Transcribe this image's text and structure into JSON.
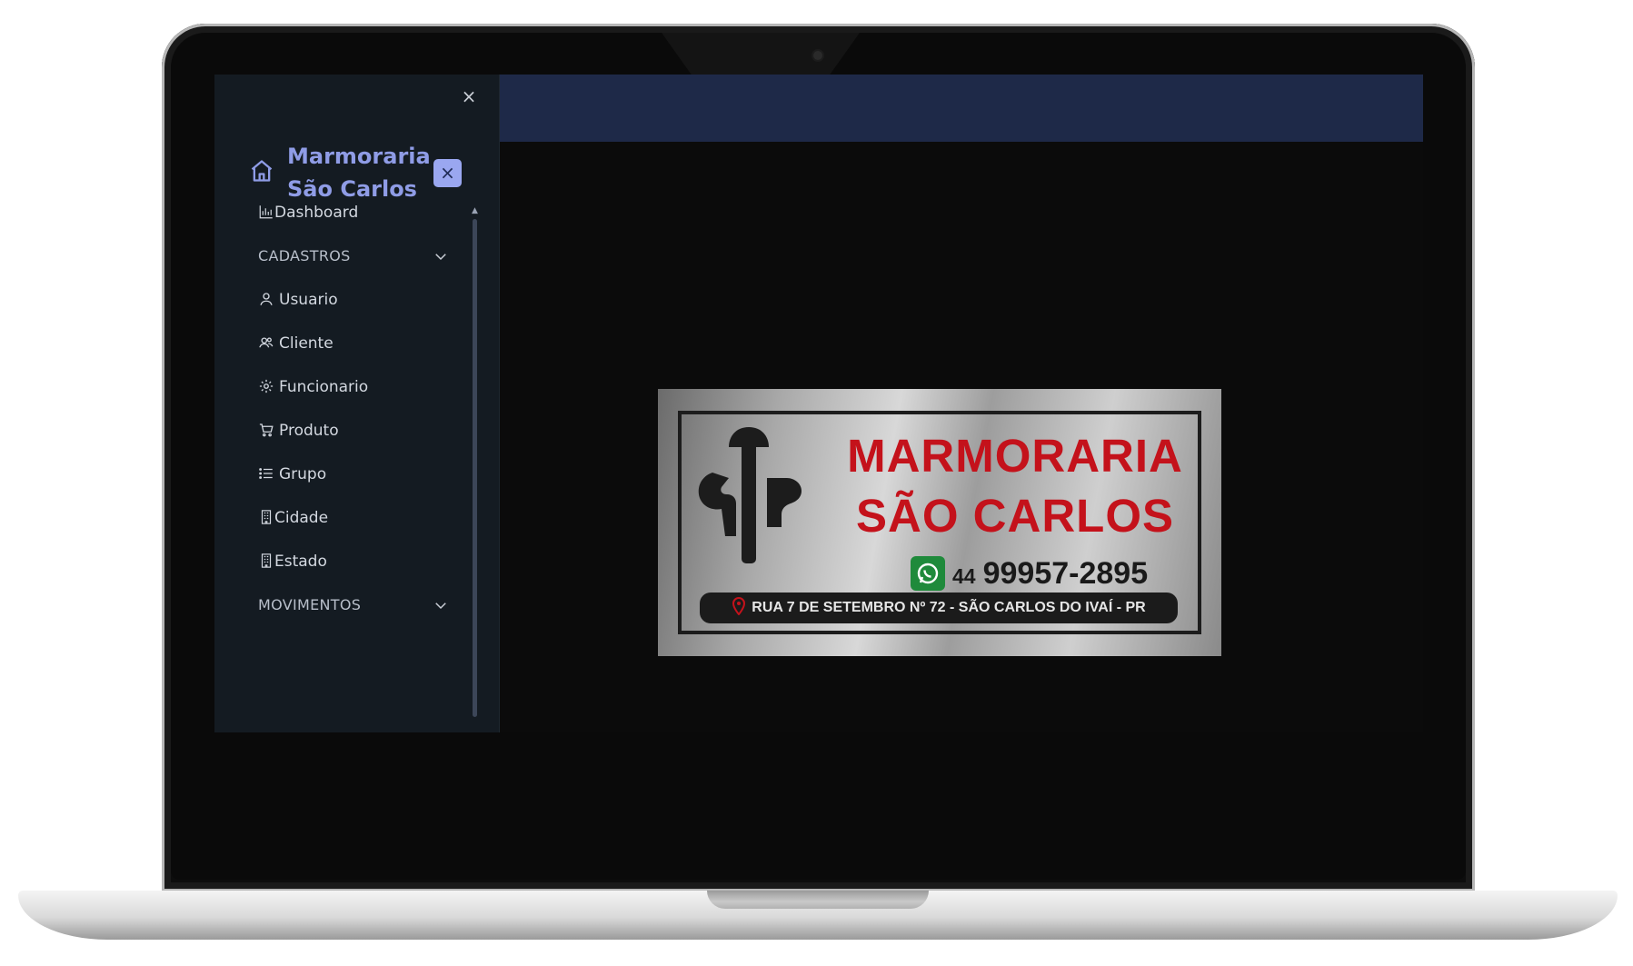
{
  "sidebar": {
    "close_glyph": "×",
    "brand": {
      "line1": "Marmoraria",
      "line2": "São Carlos",
      "icon": "home-icon",
      "close_glyph": "×"
    },
    "items": [
      {
        "label": "Dashboard",
        "icon": "bar-chart-icon"
      },
      {
        "label": "CADASTROS",
        "type": "section",
        "icon": "chevron-down-icon"
      },
      {
        "label": "Usuario",
        "icon": "user-icon"
      },
      {
        "label": "Cliente",
        "icon": "users-icon"
      },
      {
        "label": "Funcionario",
        "icon": "gear-icon"
      },
      {
        "label": "Produto",
        "icon": "cart-icon"
      },
      {
        "label": "Grupo",
        "icon": "list-icon"
      },
      {
        "label": "Cidade",
        "icon": "building-icon"
      },
      {
        "label": "Estado",
        "icon": "building-icon"
      },
      {
        "label": "MOVIMENTOS",
        "type": "section",
        "icon": "chevron-down-icon"
      }
    ]
  },
  "logo": {
    "title_line1": "MARMORARIA",
    "title_line2": "SÃO CARLOS",
    "ddd": "44",
    "phone": "99957-2895",
    "address": "RUA 7 DE SETEMBRO Nº 72 - SÃO CARLOS DO IVAÍ - PR"
  },
  "colors": {
    "topbar": "#1e2948",
    "sidebar_bg": "#141b22",
    "brand_accent": "#8f9ce6",
    "logo_red": "#c4121b"
  }
}
